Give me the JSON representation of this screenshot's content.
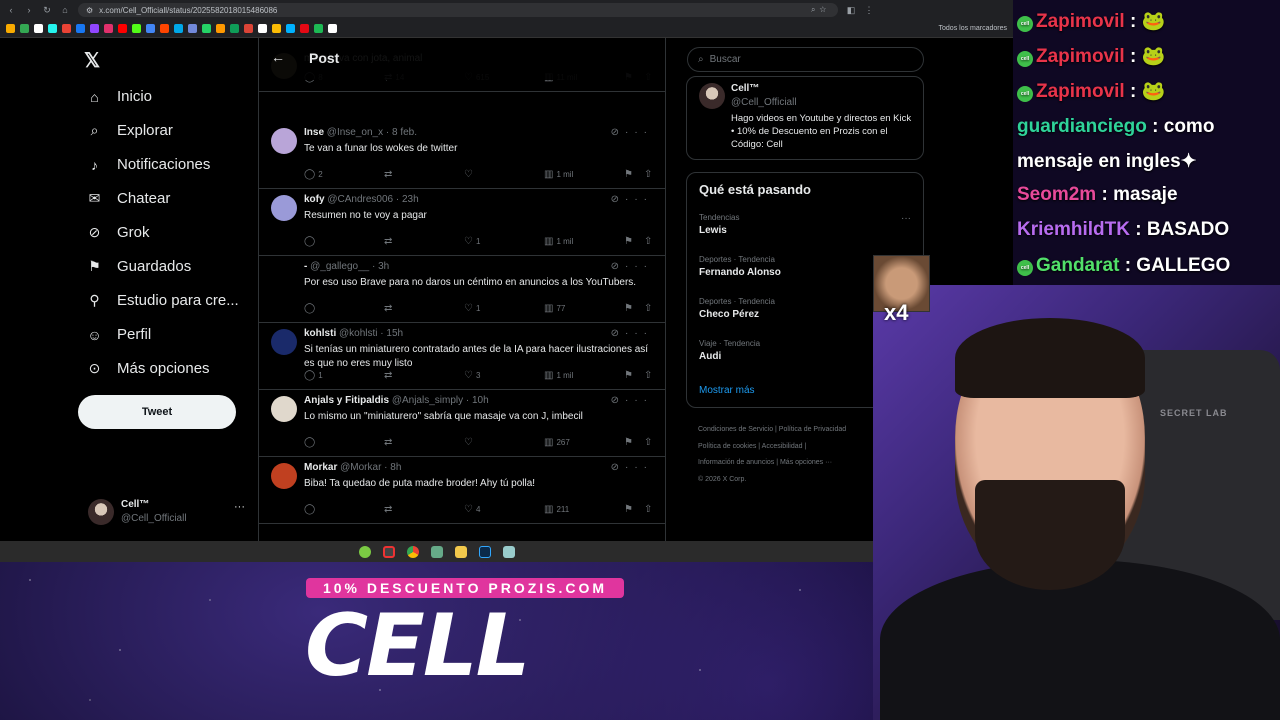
{
  "browser": {
    "url": "x.com/Cell_Officiall/status/2025582018015486086",
    "bookmarks_all": "Todos los marcadores"
  },
  "x": {
    "nav": [
      {
        "label": "Inicio",
        "icon": "home-icon"
      },
      {
        "label": "Explorar",
        "icon": "search-icon"
      },
      {
        "label": "Notificaciones",
        "icon": "bell-icon"
      },
      {
        "label": "Chatear",
        "icon": "mail-icon"
      },
      {
        "label": "Grok",
        "icon": "grok-icon"
      },
      {
        "label": "Guardados",
        "icon": "bookmark-icon"
      },
      {
        "label": "Estudio para cre...",
        "icon": "studio-icon"
      },
      {
        "label": "Perfil",
        "icon": "person-icon"
      },
      {
        "label": "Más opciones",
        "icon": "more-icon"
      }
    ],
    "tweet_button": "Tweet",
    "account": {
      "name": "Cell™",
      "handle": "@Cell_Officiall"
    },
    "header_title": "Post",
    "tweets": [
      {
        "name": "",
        "handle": "",
        "time": "",
        "text": "masaje va con jota, animal",
        "replies": "8",
        "retweets": "14",
        "likes": "615",
        "views": "11 mil"
      },
      {
        "name": "Inse",
        "handle": "@Inse_on_x",
        "time": "8 feb.",
        "text": "Te van a funar los wokes de twitter",
        "replies": "2",
        "retweets": "",
        "likes": "",
        "views": "1 mil"
      },
      {
        "name": "kofy",
        "handle": "@CAndres006",
        "time": "23h",
        "text": "Resumen no te voy a pagar",
        "replies": "",
        "retweets": "",
        "likes": "1",
        "views": "1 mil"
      },
      {
        "name": "-",
        "handle": "@_gallego__",
        "time": "3h",
        "text": "Por eso uso Brave para no daros un céntimo en anuncios a los YouTubers.",
        "replies": "",
        "retweets": "",
        "likes": "1",
        "views": "77"
      },
      {
        "name": "kohlsti",
        "handle": "@kohlsti",
        "time": "15h",
        "text": "Si tenías un miniaturero contratado antes de la IA para hacer ilustraciones así es que no eres muy listo",
        "replies": "1",
        "retweets": "",
        "likes": "3",
        "views": "1 mil"
      },
      {
        "name": "Anjals y Fitipaldis",
        "handle": "@Anjals_simply",
        "time": "10h",
        "text": "Lo mismo un \"miniaturero\" sabría que masaje va con  J, imbecil",
        "replies": "",
        "retweets": "",
        "likes": "",
        "views": "267"
      },
      {
        "name": "Morkar",
        "handle": "@Morkar",
        "time": "8h",
        "text": "Biba! Ta quedao de puta madre broder! Ahy tú polla!",
        "replies": "",
        "retweets": "",
        "likes": "4",
        "views": "211"
      }
    ],
    "search_placeholder": "Buscar",
    "profile_card": {
      "name": "Cell™",
      "handle": "@Cell_Officiall",
      "bio": "Hago videos en Youtube y directos en Kick • 10% de Descuento en Prozis con el Código: Cell"
    },
    "trends": {
      "title": "Qué está pasando",
      "items": [
        {
          "context": "Tendencias",
          "name": "Lewis"
        },
        {
          "context": "Deportes · Tendencia",
          "name": "Fernando Alonso"
        },
        {
          "context": "Deportes · Tendencia",
          "name": "Checo Pérez"
        },
        {
          "context": "Viaje · Tendencia",
          "name": "Audi"
        }
      ],
      "show_more": "Mostrar más"
    },
    "footer": {
      "line1": "Condiciones de Servicio  |  Política de Privacidad",
      "line2": "Política de cookies  |  Accesibilidad  |",
      "line3": "Información de anuncios  |  Más opciones ···",
      "line4": "© 2026 X Corp."
    }
  },
  "chat": [
    {
      "user": "Zapimovil",
      "message": ": 🐸",
      "color": "#e8344a",
      "badge": true
    },
    {
      "user": "Zapimovil",
      "message": ": 🐸",
      "color": "#e8344a",
      "badge": true
    },
    {
      "user": "Zapimovil",
      "message": ": 🐸",
      "color": "#e8344a",
      "badge": true
    },
    {
      "user": "guardianciego",
      "message": ": como",
      "color": "#2fd39a",
      "badge": false
    },
    {
      "user": "",
      "message": "mensaje en ingles✦",
      "color": "#2fd39a",
      "badge": false
    },
    {
      "user": "Seom2m",
      "message": ": masaje",
      "color": "#e84a9a",
      "badge": false
    },
    {
      "user": "KriemhildTK",
      "message": ": BASADO",
      "color": "#b86cf0",
      "badge": false
    },
    {
      "user": "Gandarat",
      "message": ": GALLEGO",
      "color": "#52e06a",
      "badge": true
    }
  ],
  "overlay": {
    "emote_count": "x4",
    "promo_banner": "10% DESCUENTO PROZIS.COM",
    "promo_logo": "CELL",
    "chair_brand": "SECRET LAB"
  }
}
